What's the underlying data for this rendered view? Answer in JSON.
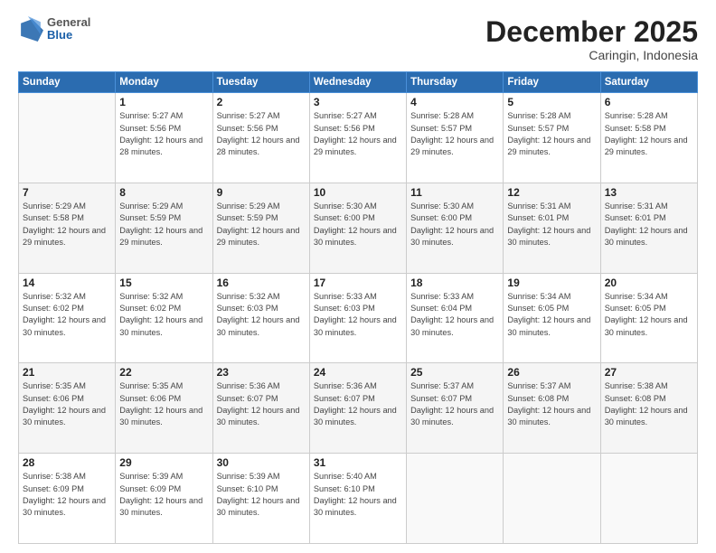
{
  "header": {
    "logo": {
      "general": "General",
      "blue": "Blue"
    },
    "title": "December 2025",
    "location": "Caringin, Indonesia"
  },
  "days_of_week": [
    "Sunday",
    "Monday",
    "Tuesday",
    "Wednesday",
    "Thursday",
    "Friday",
    "Saturday"
  ],
  "weeks": [
    [
      {
        "day": "",
        "empty": true
      },
      {
        "day": "1",
        "sunrise": "5:27 AM",
        "sunset": "5:56 PM",
        "daylight": "12 hours and 28 minutes."
      },
      {
        "day": "2",
        "sunrise": "5:27 AM",
        "sunset": "5:56 PM",
        "daylight": "12 hours and 28 minutes."
      },
      {
        "day": "3",
        "sunrise": "5:27 AM",
        "sunset": "5:56 PM",
        "daylight": "12 hours and 29 minutes."
      },
      {
        "day": "4",
        "sunrise": "5:28 AM",
        "sunset": "5:57 PM",
        "daylight": "12 hours and 29 minutes."
      },
      {
        "day": "5",
        "sunrise": "5:28 AM",
        "sunset": "5:57 PM",
        "daylight": "12 hours and 29 minutes."
      },
      {
        "day": "6",
        "sunrise": "5:28 AM",
        "sunset": "5:58 PM",
        "daylight": "12 hours and 29 minutes."
      }
    ],
    [
      {
        "day": "7",
        "sunrise": "5:29 AM",
        "sunset": "5:58 PM",
        "daylight": "12 hours and 29 minutes."
      },
      {
        "day": "8",
        "sunrise": "5:29 AM",
        "sunset": "5:59 PM",
        "daylight": "12 hours and 29 minutes."
      },
      {
        "day": "9",
        "sunrise": "5:29 AM",
        "sunset": "5:59 PM",
        "daylight": "12 hours and 29 minutes."
      },
      {
        "day": "10",
        "sunrise": "5:30 AM",
        "sunset": "6:00 PM",
        "daylight": "12 hours and 30 minutes."
      },
      {
        "day": "11",
        "sunrise": "5:30 AM",
        "sunset": "6:00 PM",
        "daylight": "12 hours and 30 minutes."
      },
      {
        "day": "12",
        "sunrise": "5:31 AM",
        "sunset": "6:01 PM",
        "daylight": "12 hours and 30 minutes."
      },
      {
        "day": "13",
        "sunrise": "5:31 AM",
        "sunset": "6:01 PM",
        "daylight": "12 hours and 30 minutes."
      }
    ],
    [
      {
        "day": "14",
        "sunrise": "5:32 AM",
        "sunset": "6:02 PM",
        "daylight": "12 hours and 30 minutes."
      },
      {
        "day": "15",
        "sunrise": "5:32 AM",
        "sunset": "6:02 PM",
        "daylight": "12 hours and 30 minutes."
      },
      {
        "day": "16",
        "sunrise": "5:32 AM",
        "sunset": "6:03 PM",
        "daylight": "12 hours and 30 minutes."
      },
      {
        "day": "17",
        "sunrise": "5:33 AM",
        "sunset": "6:03 PM",
        "daylight": "12 hours and 30 minutes."
      },
      {
        "day": "18",
        "sunrise": "5:33 AM",
        "sunset": "6:04 PM",
        "daylight": "12 hours and 30 minutes."
      },
      {
        "day": "19",
        "sunrise": "5:34 AM",
        "sunset": "6:05 PM",
        "daylight": "12 hours and 30 minutes."
      },
      {
        "day": "20",
        "sunrise": "5:34 AM",
        "sunset": "6:05 PM",
        "daylight": "12 hours and 30 minutes."
      }
    ],
    [
      {
        "day": "21",
        "sunrise": "5:35 AM",
        "sunset": "6:06 PM",
        "daylight": "12 hours and 30 minutes."
      },
      {
        "day": "22",
        "sunrise": "5:35 AM",
        "sunset": "6:06 PM",
        "daylight": "12 hours and 30 minutes."
      },
      {
        "day": "23",
        "sunrise": "5:36 AM",
        "sunset": "6:07 PM",
        "daylight": "12 hours and 30 minutes."
      },
      {
        "day": "24",
        "sunrise": "5:36 AM",
        "sunset": "6:07 PM",
        "daylight": "12 hours and 30 minutes."
      },
      {
        "day": "25",
        "sunrise": "5:37 AM",
        "sunset": "6:07 PM",
        "daylight": "12 hours and 30 minutes."
      },
      {
        "day": "26",
        "sunrise": "5:37 AM",
        "sunset": "6:08 PM",
        "daylight": "12 hours and 30 minutes."
      },
      {
        "day": "27",
        "sunrise": "5:38 AM",
        "sunset": "6:08 PM",
        "daylight": "12 hours and 30 minutes."
      }
    ],
    [
      {
        "day": "28",
        "sunrise": "5:38 AM",
        "sunset": "6:09 PM",
        "daylight": "12 hours and 30 minutes."
      },
      {
        "day": "29",
        "sunrise": "5:39 AM",
        "sunset": "6:09 PM",
        "daylight": "12 hours and 30 minutes."
      },
      {
        "day": "30",
        "sunrise": "5:39 AM",
        "sunset": "6:10 PM",
        "daylight": "12 hours and 30 minutes."
      },
      {
        "day": "31",
        "sunrise": "5:40 AM",
        "sunset": "6:10 PM",
        "daylight": "12 hours and 30 minutes."
      },
      {
        "day": "",
        "empty": true
      },
      {
        "day": "",
        "empty": true
      },
      {
        "day": "",
        "empty": true
      }
    ]
  ]
}
